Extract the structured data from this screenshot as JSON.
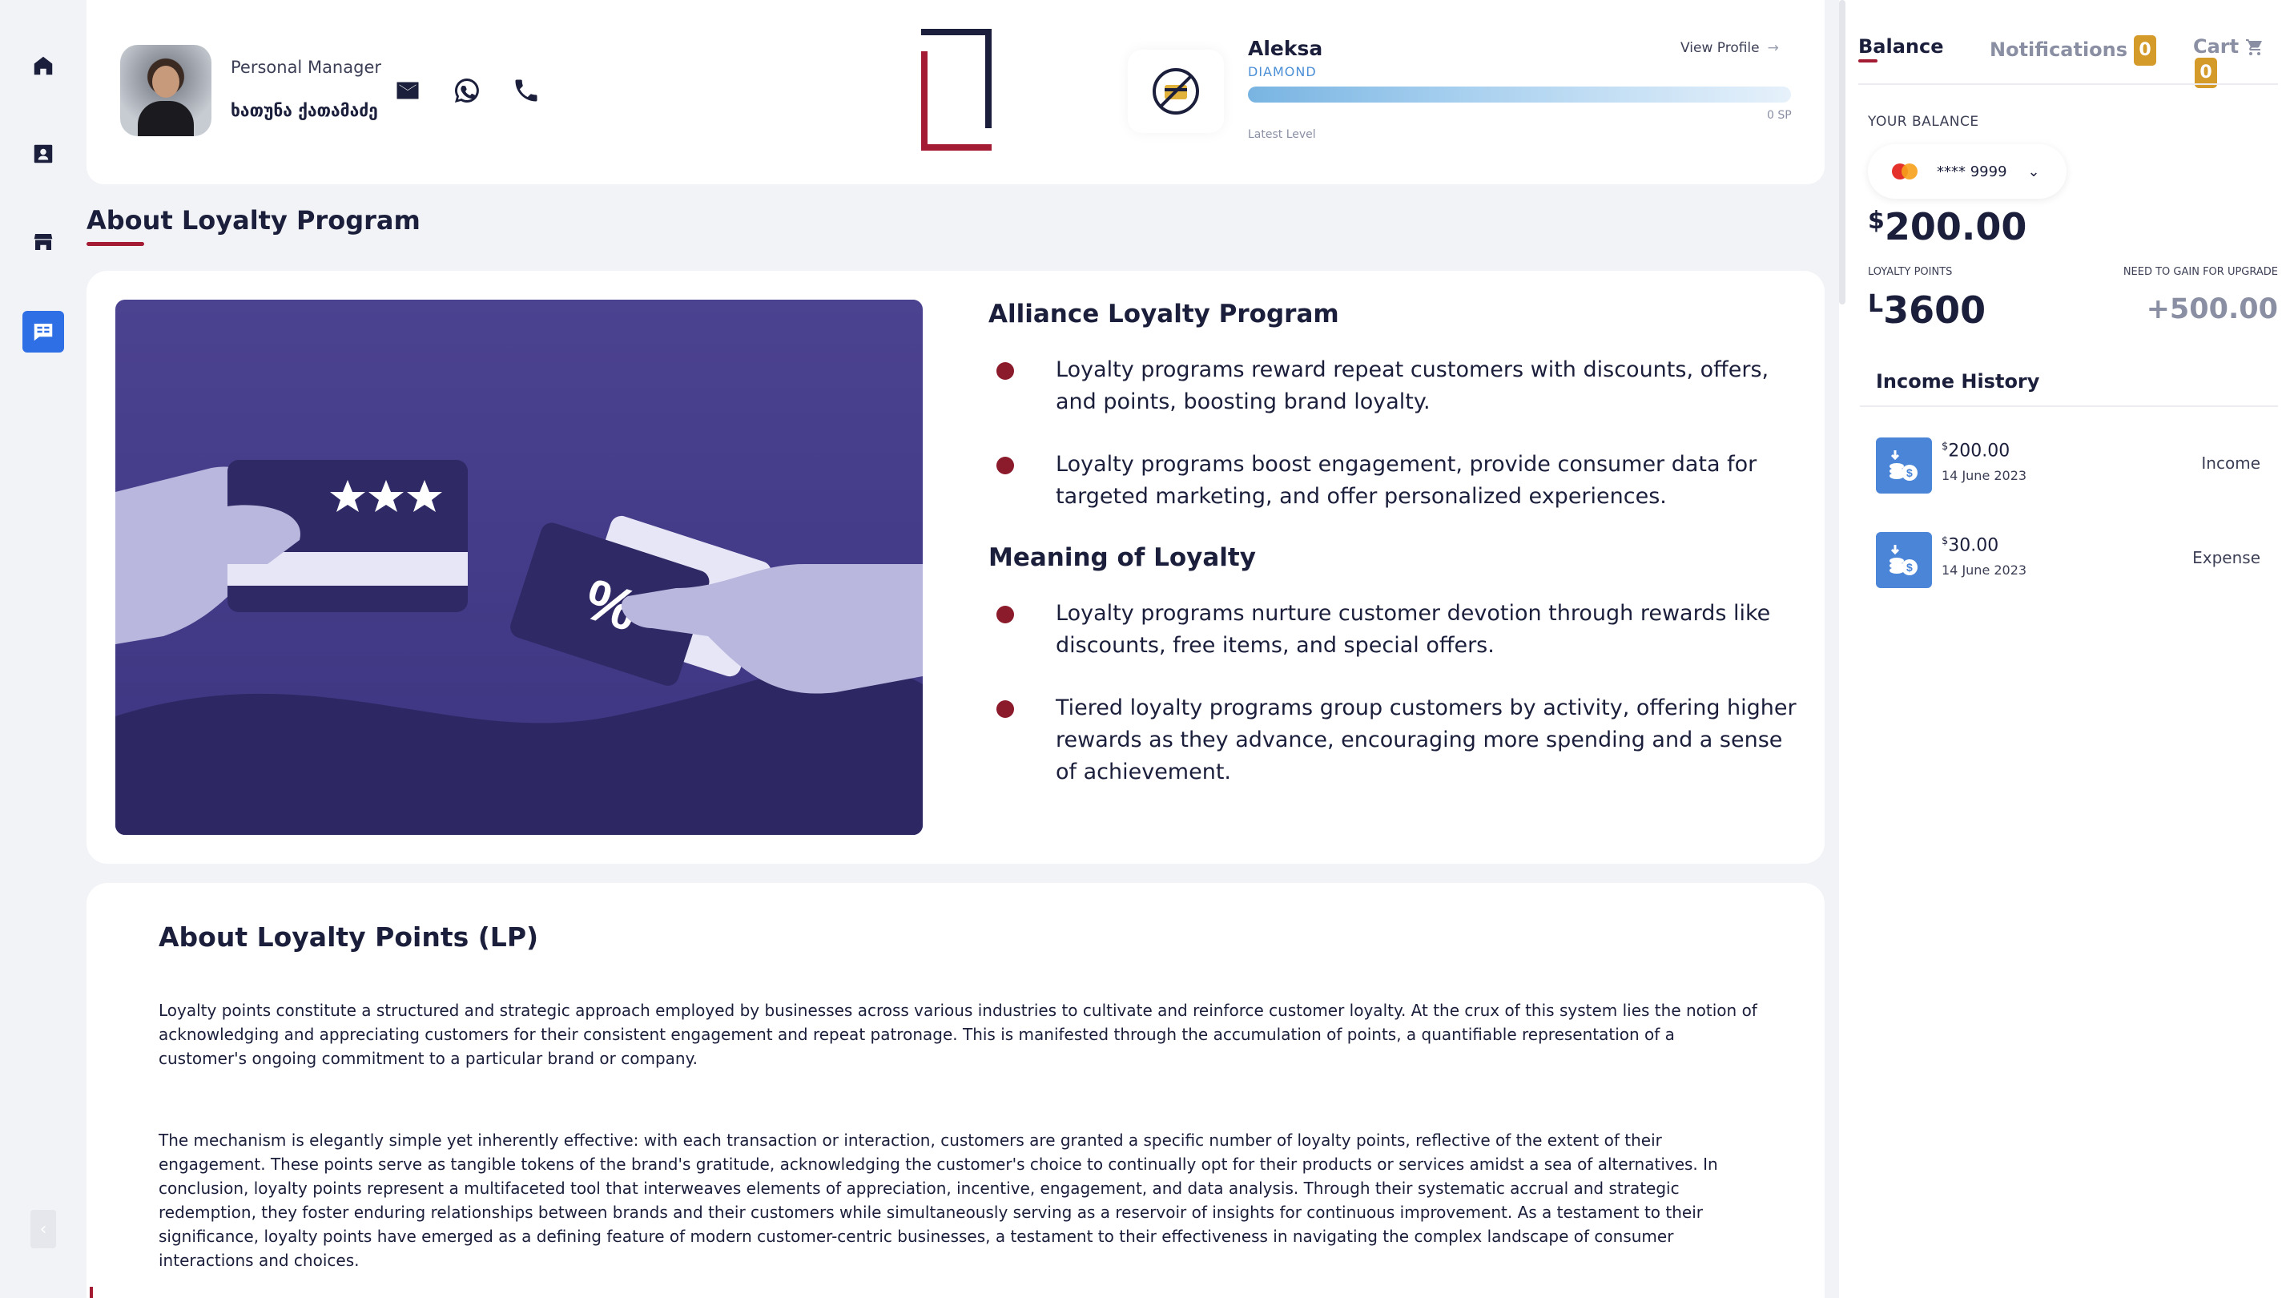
{
  "manager": {
    "label": "Personal Manager",
    "name": "ხათუნა ქათამაძე"
  },
  "profile": {
    "name": "Aleksa",
    "tier": "DIAMOND",
    "view_profile": "View Profile",
    "points_label": "0 SP",
    "level_label": "Latest Level"
  },
  "about": {
    "title": "About Loyalty Program"
  },
  "program": {
    "heading1": "Alliance Loyalty Program",
    "bullets1": [
      "Loyalty programs reward repeat customers with discounts, offers, and points, boosting brand loyalty.",
      "Loyalty programs boost engagement, provide consumer data for targeted marketing, and offer personalized experiences."
    ],
    "heading2": "Meaning of Loyalty",
    "bullets2": [
      "Loyalty programs nurture customer devotion through rewards like discounts, free items, and special offers.",
      "Tiered loyalty programs group customers by activity, offering higher rewards as they advance, encouraging more spending and a sense of achievement."
    ]
  },
  "points": {
    "heading": "About Loyalty Points (LP)",
    "paragraphs": [
      "Loyalty points constitute a structured and strategic approach employed by businesses across various industries to cultivate and reinforce customer loyalty. At the crux of this system lies the notion of acknowledging and appreciating customers for their consistent engagement and repeat patronage. This is manifested through the accumulation of points, a quantifiable representation of a customer's ongoing commitment to a particular brand or company.",
      "The mechanism is elegantly simple yet inherently effective: with each transaction or interaction, customers are granted a specific number of loyalty points, reflective of the extent of their engagement. These points serve as tangible tokens of the brand's gratitude, acknowledging the customer's choice to continually opt for their products or services amidst a sea of alternatives. In conclusion, loyalty points represent a multifaceted tool that interweaves elements of appreciation, incentive, engagement, and data analysis. Through their systematic accrual and strategic redemption, they foster enduring relationships between brands and their customers while simultaneously serving as a reservoir of insights for continuous improvement. As a testament to their significance, loyalty points have emerged as a defining feature of modern customer-centric businesses, a testament to their effectiveness in navigating the complex landscape of consumer interactions and choices."
    ]
  },
  "panel": {
    "tabs": {
      "balance": "Balance",
      "notifications": "Notifications",
      "notifications_count": "0",
      "cart": "Cart",
      "cart_count": "0"
    },
    "your_balance": "YOUR BALANCE",
    "card_number": "**** 9999",
    "balance_currency": "$",
    "balance_value": "200.00",
    "lp_label": "LOYALTY POINTS",
    "lp_currency": "L",
    "lp_value": "3600",
    "upgrade_label": "NEED TO GAIN FOR UPGRADE",
    "upgrade_value": "+500.00",
    "income_history_title": "Income History",
    "history": [
      {
        "currency": "$",
        "amount": "200.00",
        "date": "14 June 2023",
        "type": "Income"
      },
      {
        "currency": "$",
        "amount": "30.00",
        "date": "14 June 2023",
        "type": "Expense"
      }
    ]
  },
  "colors": {
    "accent_red": "#a31c34",
    "bullet_red": "#8b1a2b",
    "nav_active_blue": "#2f6fe5",
    "badge_gold": "#d49a2a",
    "illustration_purple": "#4a3f8c"
  },
  "icons": {
    "nav": [
      "home-icon",
      "contact-card-icon",
      "store-icon",
      "loyalty-book-icon"
    ],
    "contact": [
      "mail-icon",
      "whatsapp-icon",
      "phone-icon"
    ],
    "cart_icon": "cart-icon",
    "history_icon": "coin-deposit-icon"
  }
}
